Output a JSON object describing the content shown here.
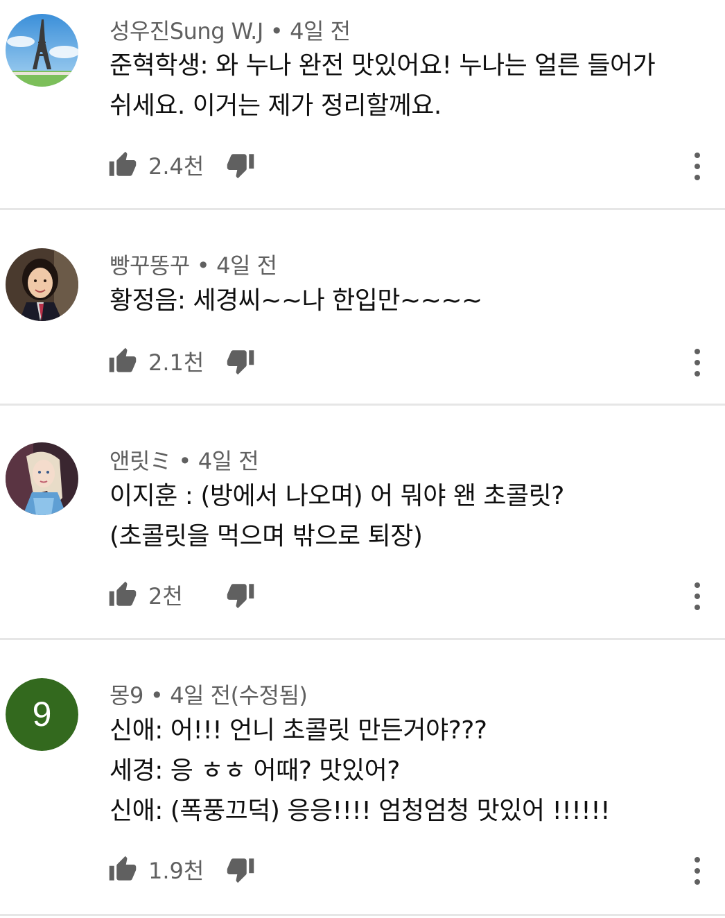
{
  "comments": [
    {
      "author": "성우진Sung W.J",
      "sep": "•",
      "time": "4일 전",
      "lines": [
        "준혁학생: 와 누나 완전 맛있어요! 누나는 얼른 들어가",
        "쉬세요. 이거는 제가 정리할께요."
      ],
      "likes": "2.4천",
      "avatar": "eiffel-tower"
    },
    {
      "author": "빵꾸똥꾸",
      "sep": "•",
      "time": "4일 전",
      "lines": [
        "황정음: 세경씨~~나 한입만~~~~"
      ],
      "likes": "2.1천",
      "avatar": "girl-photo"
    },
    {
      "author": "앤릿ミ",
      "sep": "•",
      "time": "4일 전",
      "lines": [
        "이지훈 : (방에서 나오며) 어 뭐야 왠 초콜릿?",
        "(초콜릿을 먹으며 밖으로 퇴장)"
      ],
      "likes": "2천",
      "avatar": "elsa-photo"
    },
    {
      "author": "몽9",
      "sep": "•",
      "time": "4일 전(수정됨)",
      "lines": [
        "신애: 어!!! 언니 초콜릿 만든거야???",
        "세경: 응 ㅎㅎ 어때? 맛있어?",
        "신애: (폭풍끄덕) 응응!!!! 엄청엄청 맛있어 !!!!!!"
      ],
      "likes": "1.9천",
      "avatar": "letter",
      "avatar_letter": "9",
      "avatar_color": "#33691e"
    }
  ]
}
